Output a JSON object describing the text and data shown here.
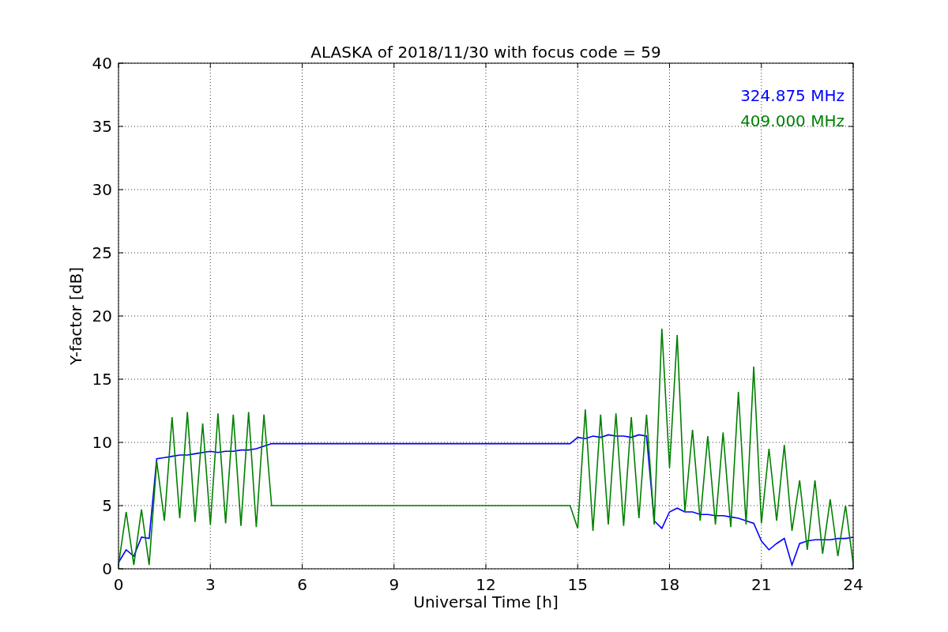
{
  "chart_data": {
    "type": "line",
    "title": "ALASKA of 2018/11/30 with focus code = 59",
    "xlabel": "Universal Time [h]",
    "ylabel": "Y-factor [dB]",
    "xlim": [
      0,
      24
    ],
    "ylim": [
      0,
      40
    ],
    "xticks": [
      0,
      3,
      6,
      9,
      12,
      15,
      18,
      21,
      24
    ],
    "yticks": [
      0,
      5,
      10,
      15,
      20,
      25,
      30,
      35,
      40
    ],
    "grid": true,
    "x": [
      0,
      0.25,
      0.5,
      0.75,
      1,
      1.25,
      1.5,
      1.75,
      2,
      2.25,
      2.5,
      2.75,
      3,
      3.25,
      3.5,
      3.75,
      4,
      4.25,
      4.5,
      4.75,
      5,
      5.25,
      5.5,
      5.75,
      6,
      6.25,
      6.5,
      6.75,
      7,
      7.25,
      7.5,
      7.75,
      8,
      8.25,
      8.5,
      8.75,
      9,
      9.25,
      9.5,
      9.75,
      10,
      10.25,
      10.5,
      10.75,
      11,
      11.25,
      11.5,
      11.75,
      12,
      12.25,
      12.5,
      12.75,
      13,
      13.25,
      13.5,
      13.75,
      14,
      14.25,
      14.5,
      14.75,
      15,
      15.25,
      15.5,
      15.75,
      16,
      16.25,
      16.5,
      16.75,
      17,
      17.25,
      17.5,
      17.75,
      18,
      18.25,
      18.5,
      18.75,
      19,
      19.25,
      19.5,
      19.75,
      20,
      20.25,
      20.5,
      20.75,
      21,
      21.25,
      21.5,
      21.75,
      22,
      22.25,
      22.5,
      22.75,
      23,
      23.25,
      23.5,
      23.75,
      24
    ],
    "series": [
      {
        "name": "324.875 MHz",
        "color": "#0000ff",
        "values": [
          0.5,
          1.5,
          1.0,
          2.5,
          2.4,
          8.7,
          8.8,
          8.9,
          9.0,
          9.0,
          9.1,
          9.2,
          9.3,
          9.2,
          9.3,
          9.3,
          9.4,
          9.4,
          9.5,
          9.7,
          9.9,
          9.9,
          9.9,
          9.9,
          9.9,
          9.9,
          9.9,
          9.9,
          9.9,
          9.9,
          9.9,
          9.9,
          9.9,
          9.9,
          9.9,
          9.9,
          9.9,
          9.9,
          9.9,
          9.9,
          9.9,
          9.9,
          9.9,
          9.9,
          9.9,
          9.9,
          9.9,
          9.9,
          9.9,
          9.9,
          9.9,
          9.9,
          9.9,
          9.9,
          9.9,
          9.9,
          9.9,
          9.9,
          9.9,
          9.9,
          10.4,
          10.3,
          10.5,
          10.4,
          10.6,
          10.5,
          10.5,
          10.4,
          10.6,
          10.5,
          3.8,
          3.2,
          4.5,
          4.8,
          4.5,
          4.5,
          4.3,
          4.3,
          4.2,
          4.2,
          4.1,
          4.0,
          3.8,
          3.6,
          2.2,
          1.5,
          2.0,
          2.4,
          0.3,
          2.0,
          2.2,
          2.3,
          2.3,
          2.3,
          2.4,
          2.4,
          2.5
        ]
      },
      {
        "name": "409.000 MHz",
        "color": "#008000",
        "values": [
          0.3,
          4.5,
          0.3,
          4.7,
          0.3,
          8.5,
          3.8,
          12.0,
          4.0,
          12.4,
          3.7,
          11.5,
          3.5,
          12.3,
          3.6,
          12.2,
          3.4,
          12.4,
          3.3,
          12.2,
          5.0,
          5.0,
          5.0,
          5.0,
          5.0,
          5.0,
          5.0,
          5.0,
          5.0,
          5.0,
          5.0,
          5.0,
          5.0,
          5.0,
          5.0,
          5.0,
          5.0,
          5.0,
          5.0,
          5.0,
          5.0,
          5.0,
          5.0,
          5.0,
          5.0,
          5.0,
          5.0,
          5.0,
          5.0,
          5.0,
          5.0,
          5.0,
          5.0,
          5.0,
          5.0,
          5.0,
          5.0,
          5.0,
          5.0,
          5.0,
          3.2,
          12.6,
          3.0,
          12.2,
          3.5,
          12.3,
          3.4,
          12.0,
          4.0,
          12.2,
          3.5,
          19.0,
          8.0,
          18.5,
          4.5,
          11.0,
          3.8,
          10.5,
          3.5,
          10.8,
          3.3,
          14.0,
          3.5,
          16.0,
          3.6,
          9.5,
          3.8,
          9.8,
          3.0,
          7.0,
          1.5,
          7.0,
          1.2,
          5.5,
          1.0,
          5.0,
          0.4
        ]
      }
    ]
  }
}
